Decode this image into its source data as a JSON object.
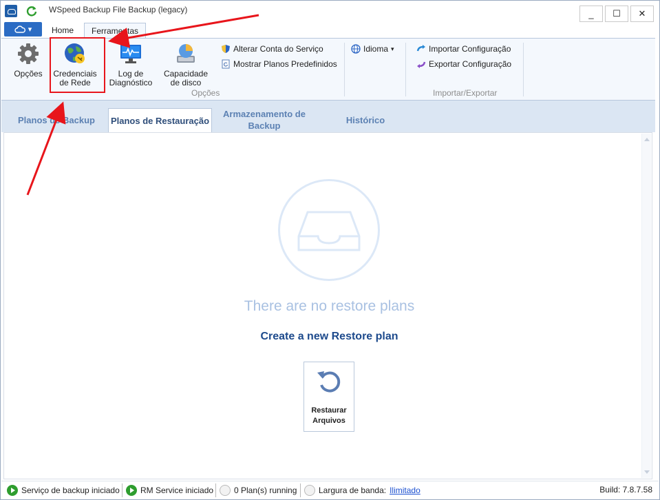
{
  "window": {
    "title": "WSpeed Backup File Backup (legacy)",
    "controls": {
      "minimize": "_",
      "maximize": "☐",
      "close": "✕"
    }
  },
  "ribbon_tabs": {
    "home": "Home",
    "tools": "Ferramentas"
  },
  "app_menu": {
    "icon": "cloud-icon",
    "caret": "▾"
  },
  "ribbon": {
    "options_group": {
      "label": "Opções",
      "buttons": {
        "options": "Opções",
        "credentials_line1": "Credenciais",
        "credentials_line2": "de Rede",
        "log_line1": "Log de",
        "log_line2": "Diagnóstico",
        "capacity_line1": "Capacidade",
        "capacity_line2": "de disco"
      },
      "small": {
        "change_account": "Alterar Conta do Serviço",
        "show_plans": "Mostrar Planos Predefinidos"
      }
    },
    "language": {
      "label": "Idioma",
      "caret": "▾"
    },
    "import_export_group": {
      "label": "Importar/Exportar",
      "import": "Importar Configuração",
      "export": "Exportar Configuração"
    }
  },
  "content_tabs": {
    "backup_plans": "Planos de Backup",
    "restore_plans": "Planos de Restauração",
    "storage_line1": "Armazenamento de",
    "storage_line2": "Backup",
    "history": "Histórico"
  },
  "empty_state": {
    "message": "There are no restore plans",
    "create_link": "Create a new Restore plan",
    "restore_button_line1": "Restaurar",
    "restore_button_line2": "Arquivos"
  },
  "status_bar": {
    "backup_service": "Serviço de backup iniciado",
    "rm_service": "RM Service iniciado",
    "plans_running": "0 Plan(s) running",
    "bandwidth_label": "Largura de banda:",
    "bandwidth_value": "Ilimitado",
    "build": "Build: 7.8.7.58"
  },
  "colors": {
    "accent": "#2b6cc4",
    "highlight_box": "#e8151b",
    "link": "#1d4a8c",
    "status_ok": "#2e9d2e"
  }
}
